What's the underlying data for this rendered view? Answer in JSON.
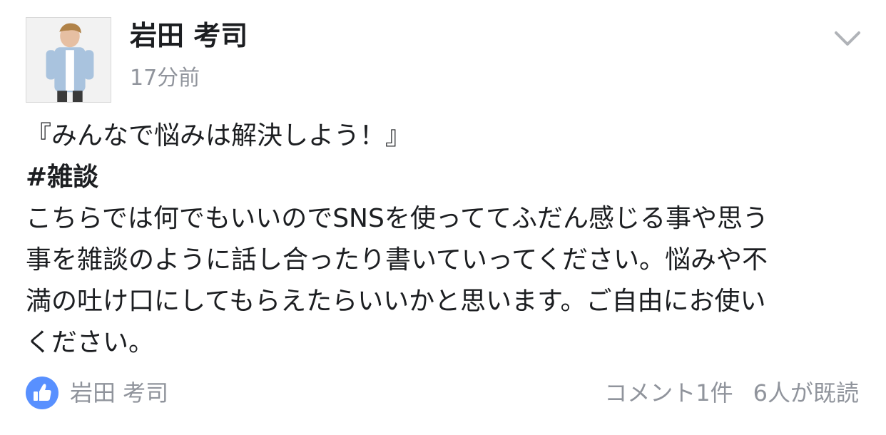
{
  "post": {
    "author": "岩田 考司",
    "timestamp": "17分前",
    "body_lines": [
      "『みんなで悩みは解決しよう！』",
      "#雑談",
      "こちらでは何でもいいのでSNSを使っててふだん感じる事や思う",
      "事を雑談のように話し合ったり書いていってください。悩みや不",
      "満の吐け口にしてもらえたらいいかと思います。ご自由にお使い",
      "ください。"
    ]
  },
  "footer": {
    "liker_name": "岩田 考司",
    "comments": "コメント1件",
    "seen_by": "6人が既読"
  },
  "icons": {
    "menu": "chevron-down-icon",
    "like": "thumbs-up-icon",
    "avatar": "profile-photo"
  },
  "colors": {
    "like_blue": "#5890ff",
    "meta_gray": "#90949c",
    "text": "#1c1e21"
  }
}
